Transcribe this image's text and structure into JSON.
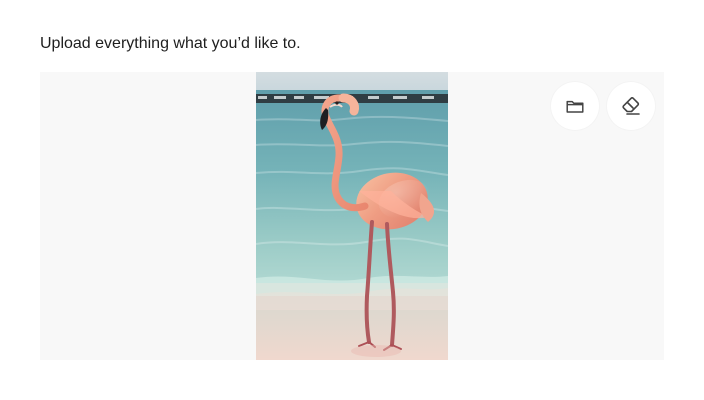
{
  "upload": {
    "title": "Upload everything what you’d like to."
  },
  "preview": {
    "background": "#f8f8f8",
    "image_subject": "flamingo-on-beach"
  },
  "actions": {
    "browse_icon": "folder-icon",
    "clear_icon": "eraser-icon",
    "icon_color": "#444444"
  }
}
